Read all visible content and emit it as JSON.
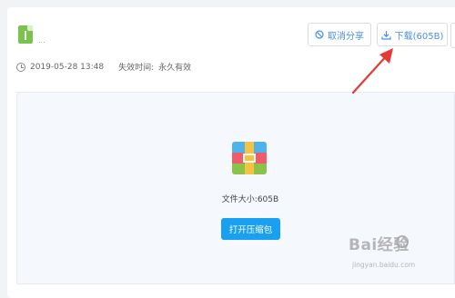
{
  "header": {
    "file_name": "..."
  },
  "actions": {
    "cancel_share_label": "取消分享",
    "download_label": "下载(605B)"
  },
  "meta": {
    "date": "2019-05-28 13:48",
    "expiry_label": "失效时间:",
    "expiry_value": "永久有效"
  },
  "preview": {
    "file_size_text": "文件大小:605B",
    "open_archive_label": "打开压缩包"
  },
  "watermark": {
    "main": "Bai经验",
    "sub": "jingyan.baidu.com"
  },
  "colors": {
    "accent": "#1aa0f0",
    "link": "#4a90e2",
    "arrow": "#e53935"
  }
}
